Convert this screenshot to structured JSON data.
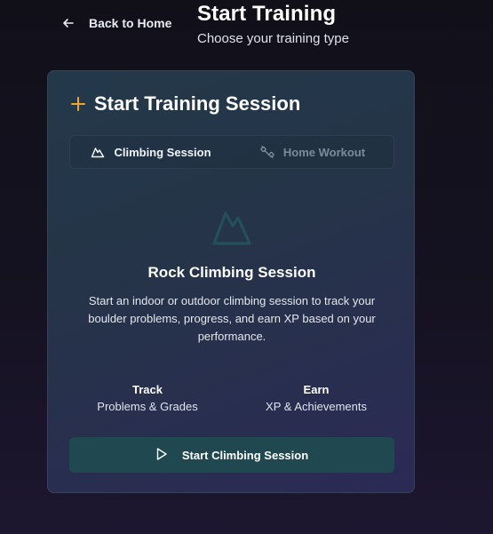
{
  "header": {
    "back_label": "Back to Home",
    "title": "Start Training",
    "subtitle": "Choose your training type"
  },
  "card": {
    "title": "Start Training Session",
    "accent_color": "#f5a524",
    "tabs": [
      {
        "label": "Climbing Session",
        "icon": "mountain-icon",
        "active": true
      },
      {
        "label": "Home Workout",
        "icon": "dumbbell-icon",
        "active": false
      }
    ],
    "hero_icon": "mountain-icon",
    "session_title": "Rock Climbing Session",
    "session_description": "Start an indoor or outdoor climbing session to track your boulder problems, progress, and earn XP based on your performance.",
    "stats": [
      {
        "label": "Track",
        "value": "Problems & Grades"
      },
      {
        "label": "Earn",
        "value": "XP & Achievements"
      }
    ],
    "start_button_label": "Start Climbing Session",
    "start_button_icon": "play-icon",
    "start_button_color": "#1f4851"
  }
}
